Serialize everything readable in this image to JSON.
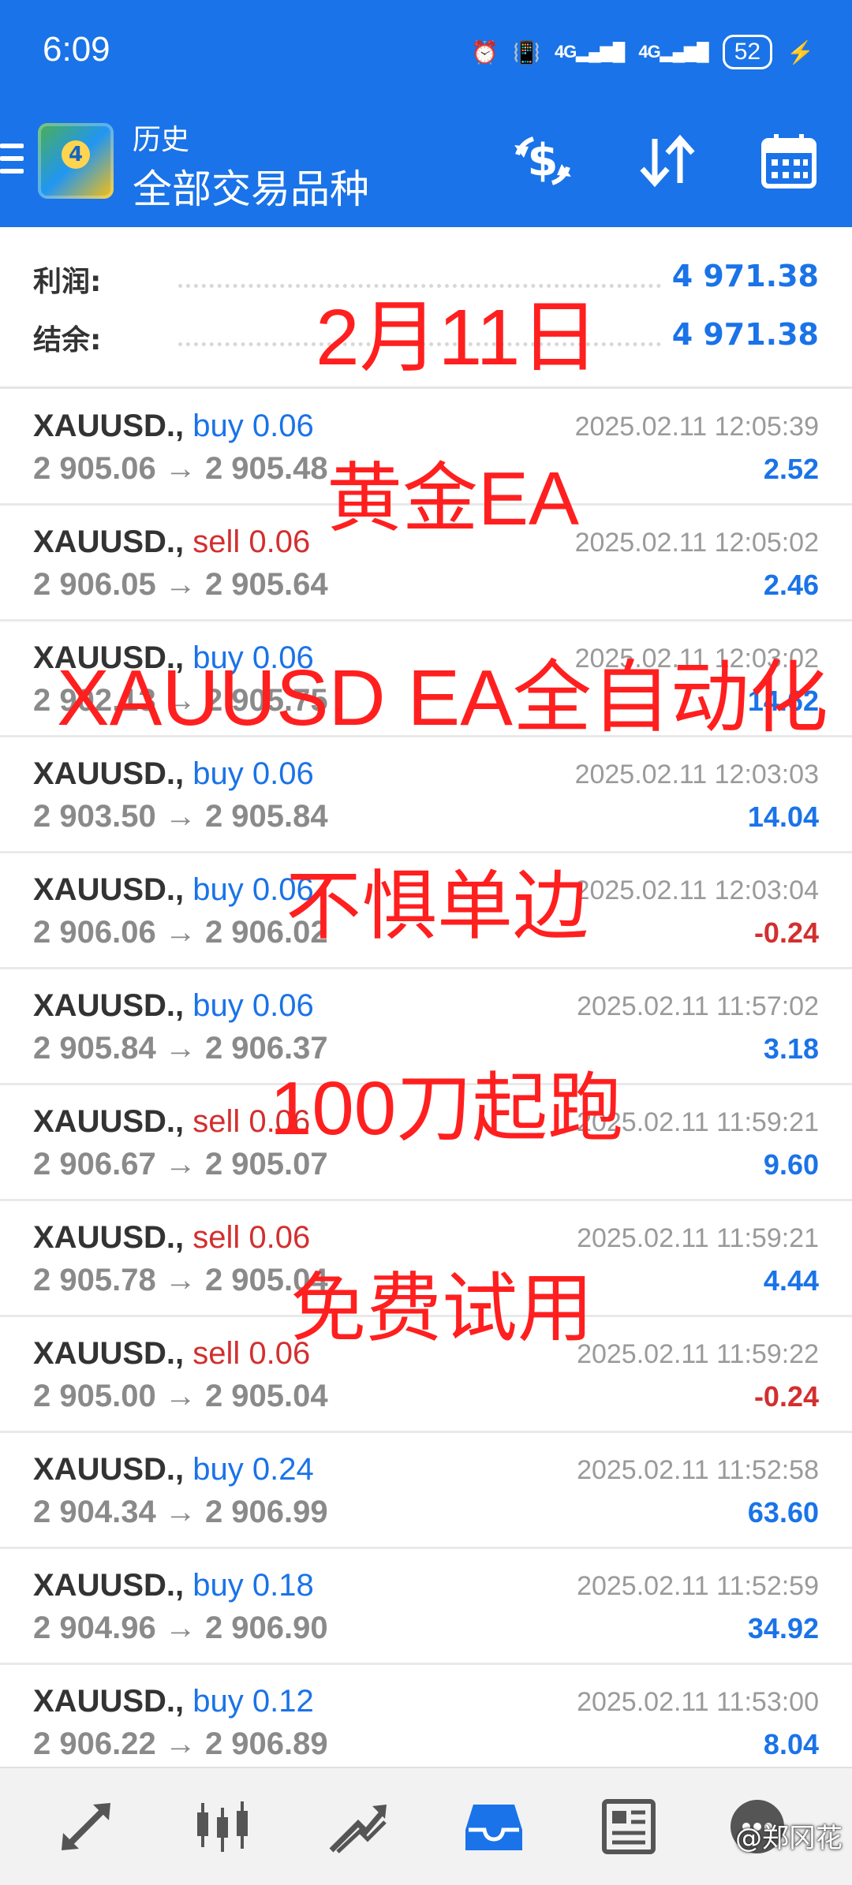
{
  "status": {
    "time": "6:09",
    "battery": "52",
    "signal1": "4G",
    "signal2": "4G"
  },
  "header": {
    "title": "历史",
    "subtitle": "全部交易品种",
    "icons": [
      "logo-icon",
      "currency-exchange-icon",
      "sort-icon",
      "calendar-icon"
    ]
  },
  "summary": {
    "profit_label": "利润:",
    "profit_value": "4 971.38",
    "balance_label": "结余:",
    "balance_value": "4 971.38"
  },
  "trades": [
    {
      "symbol": "XAUUSD.,",
      "type": "buy",
      "volume": "0.06",
      "open": "2 905.06",
      "close": "2 905.48",
      "time": "2025.02.11 12:05:39",
      "profit": "2.52"
    },
    {
      "symbol": "XAUUSD.,",
      "type": "sell",
      "volume": "0.06",
      "open": "2 906.05",
      "close": "2 905.64",
      "time": "2025.02.11 12:05:02",
      "profit": "2.46"
    },
    {
      "symbol": "XAUUSD.,",
      "type": "buy",
      "volume": "0.06",
      "open": "2 902.13",
      "close": "2 905.75",
      "time": "2025.02.11 12:03:02",
      "profit": "14.62"
    },
    {
      "symbol": "XAUUSD.,",
      "type": "buy",
      "volume": "0.06",
      "open": "2 903.50",
      "close": "2 905.84",
      "time": "2025.02.11 12:03:03",
      "profit": "14.04"
    },
    {
      "symbol": "XAUUSD.,",
      "type": "buy",
      "volume": "0.06",
      "open": "2 906.06",
      "close": "2 906.02",
      "time": "2025.02.11 12:03:04",
      "profit": "-0.24"
    },
    {
      "symbol": "XAUUSD.,",
      "type": "buy",
      "volume": "0.06",
      "open": "2 905.84",
      "close": "2 906.37",
      "time": "2025.02.11 11:57:02",
      "profit": "3.18"
    },
    {
      "symbol": "XAUUSD.,",
      "type": "sell",
      "volume": "0.06",
      "open": "2 906.67",
      "close": "2 905.07",
      "time": "2025.02.11 11:59:21",
      "profit": "9.60"
    },
    {
      "symbol": "XAUUSD.,",
      "type": "sell",
      "volume": "0.06",
      "open": "2 905.78",
      "close": "2 905.04",
      "time": "2025.02.11 11:59:21",
      "profit": "4.44"
    },
    {
      "symbol": "XAUUSD.,",
      "type": "sell",
      "volume": "0.06",
      "open": "2 905.00",
      "close": "2 905.04",
      "time": "2025.02.11 11:59:22",
      "profit": "-0.24"
    },
    {
      "symbol": "XAUUSD.,",
      "type": "buy",
      "volume": "0.24",
      "open": "2 904.34",
      "close": "2 906.99",
      "time": "2025.02.11 11:52:58",
      "profit": "63.60"
    },
    {
      "symbol": "XAUUSD.,",
      "type": "buy",
      "volume": "0.18",
      "open": "2 904.96",
      "close": "2 906.90",
      "time": "2025.02.11 11:52:59",
      "profit": "34.92"
    },
    {
      "symbol": "XAUUSD.,",
      "type": "buy",
      "volume": "0.12",
      "open": "2 906.22",
      "close": "2 906.89",
      "time": "2025.02.11 11:53:00",
      "profit": "8.04"
    }
  ],
  "overlay": {
    "date": "2月11日",
    "line1": "黄金EA",
    "line2": "XAUUSD EA全自动化",
    "line3": "不惧单边",
    "line4": "100刀起跑",
    "line5": "免费试用"
  },
  "bottom_nav": [
    "quotes-icon",
    "chart-icon",
    "trade-icon",
    "history-icon",
    "news-icon",
    "chat-icon"
  ],
  "watermark": "@郑冈花",
  "colors": {
    "accent": "#1a73e8",
    "sell": "#d32f2f",
    "overlay": "#ff1f1f"
  }
}
